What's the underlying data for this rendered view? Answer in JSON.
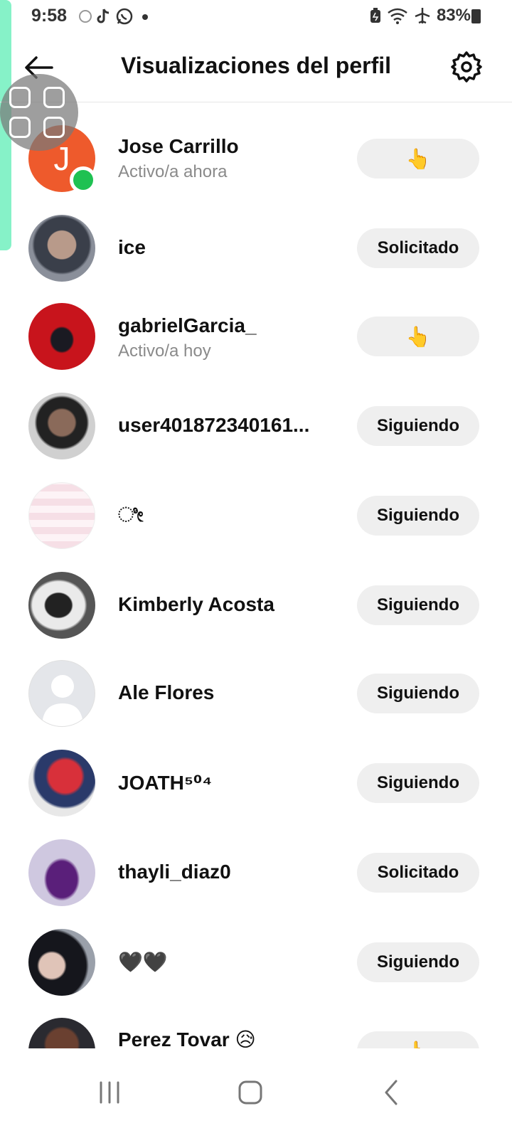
{
  "status_bar": {
    "time": "9:58",
    "battery_percent": "83%",
    "icons_left": [
      "circle-icon",
      "tiktok-icon",
      "whatsapp-icon",
      "dot-icon"
    ],
    "icons_right": [
      "battery-saver-icon",
      "wifi-icon",
      "airplane-icon",
      "battery-icon"
    ]
  },
  "header": {
    "title": "Visualizaciones del perfil",
    "back_icon": "back-arrow-icon",
    "settings_icon": "gear-icon"
  },
  "viewers": [
    {
      "name": "Jose Carrillo",
      "status": "Activo/a ahora",
      "action": "👆",
      "avatar_letter": "J",
      "online": true
    },
    {
      "name": "ice",
      "status": "",
      "action": "Solicitado"
    },
    {
      "name": "gabrielGarcia_",
      "status": "Activo/a hoy",
      "action": "👆"
    },
    {
      "name": "user401872340161...",
      "status": "",
      "action": "Siguiendo"
    },
    {
      "name": "ೀ",
      "status": "",
      "action": "Siguiendo"
    },
    {
      "name": "Kimberly Acosta",
      "status": "",
      "action": "Siguiendo"
    },
    {
      "name": "Ale Flores",
      "status": "",
      "action": "Siguiendo"
    },
    {
      "name": "JOATH⁵⁰⁴",
      "status": "",
      "action": "Siguiendo"
    },
    {
      "name": "thayli_diaz0",
      "status": "",
      "action": "Solicitado"
    },
    {
      "name": "🖤🖤",
      "status": "",
      "action": "Siguiendo"
    },
    {
      "name": "Perez Tovar 😥",
      "status": "",
      "action": "👆"
    }
  ],
  "colors": {
    "accent_handle": "#86f2c8",
    "online": "#1fc152",
    "button_bg": "#efefef",
    "avatar_orange": "#ee5a2c"
  },
  "nav_bar": {
    "icons": [
      "recent-apps-icon",
      "home-icon",
      "back-icon"
    ]
  }
}
